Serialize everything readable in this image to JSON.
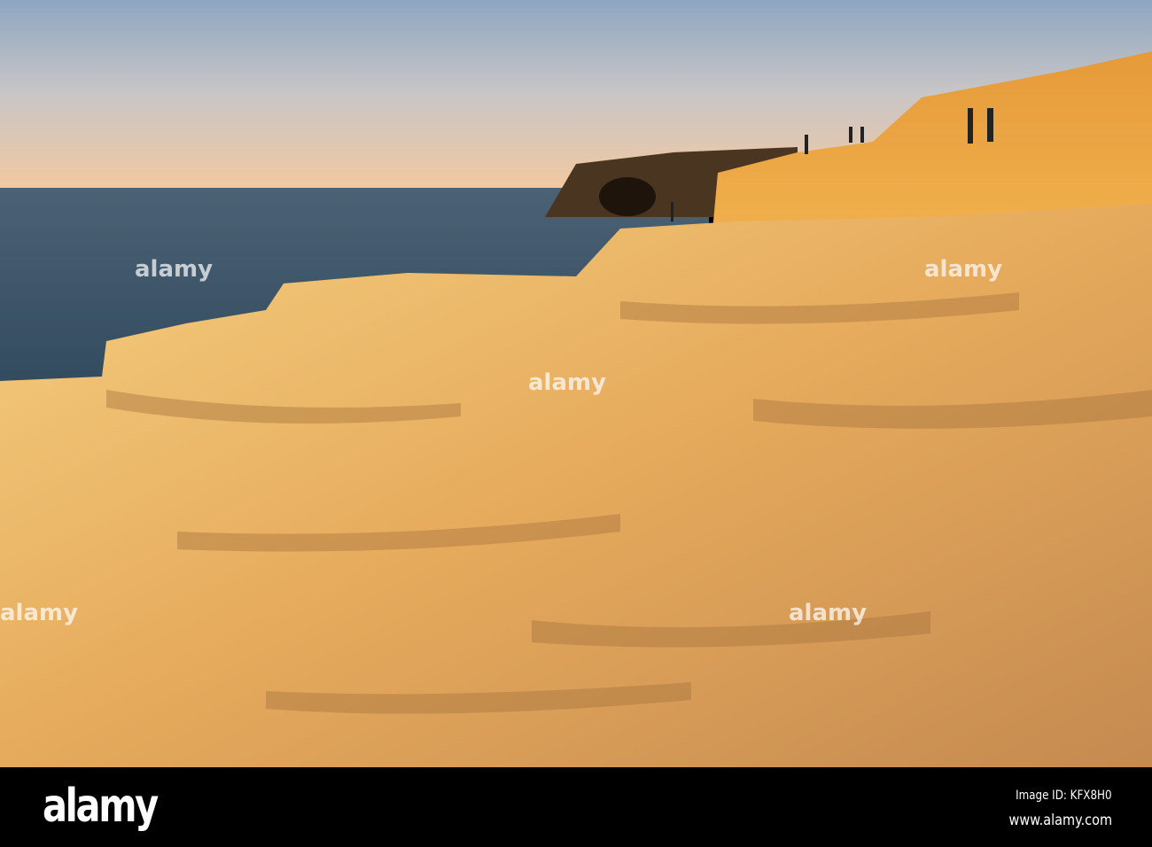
{
  "photo": {
    "subject": "Sunlit sandstone coastline with cliffs and sea at sunset",
    "watermark_text": "alamy"
  },
  "footer": {
    "logo": "alamy",
    "image_id": "Image ID: KFX8H0",
    "website": "www.alamy.com"
  },
  "colors": {
    "sky_top": "#8aa2bd",
    "sky_horizon": "#f0c9a3",
    "sea": "#3c5468",
    "rock_light": "#f3c46d",
    "rock_shadow": "#b8854e",
    "bar": "#000000"
  }
}
